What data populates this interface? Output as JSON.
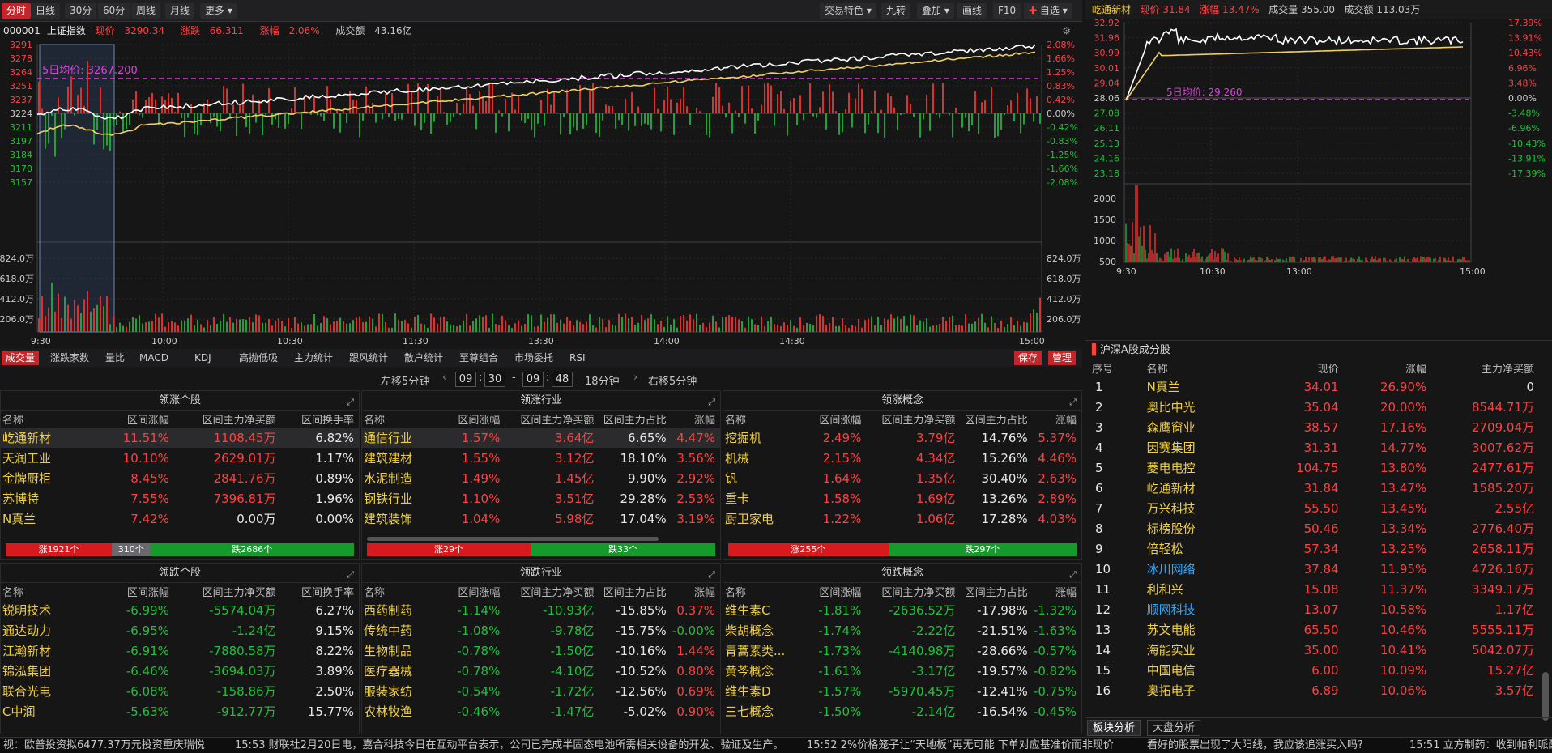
{
  "toolbar": {
    "left": [
      "分时",
      "日线",
      "30分",
      "60分",
      "周线",
      "月线",
      "更多"
    ],
    "right": [
      "交易特色",
      "九转",
      "叠加",
      "画线",
      "F10",
      "自选"
    ]
  },
  "index": {
    "code": "000001",
    "name": "上证指数",
    "price_label": "现价",
    "price": "3290.34",
    "change_label": "涨跌",
    "change": "66.311",
    "pct_label": "涨幅",
    "pct": "2.06%",
    "amount_label": "成交额",
    "amount": "43.16亿"
  },
  "main_chart": {
    "avg5_label": "5日均价: 3267.200",
    "y_left": [
      "3291",
      "3278",
      "3264",
      "3251",
      "3237",
      "3224",
      "3211",
      "3197",
      "3184",
      "3170",
      "3157"
    ],
    "y_right": [
      "2.08%",
      "1.66%",
      "1.25%",
      "0.83%",
      "0.42%",
      "0.00%",
      "-0.42%",
      "-0.83%",
      "-1.25%",
      "-1.66%",
      "-2.08%"
    ],
    "vol_left": [
      "824.0万",
      "618.0万",
      "412.0万",
      "206.0万"
    ],
    "vol_right": [
      "824.0万",
      "618.0万",
      "412.0万",
      "206.0万"
    ],
    "x": [
      "9:30",
      "10:00",
      "10:30",
      "11:30",
      "13:30",
      "14:00",
      "14:30",
      "15:00"
    ]
  },
  "indicators": [
    "成交量",
    "涨跌家数",
    "量比",
    "MACD",
    "KDJ",
    "高抛低吸",
    "主力统计",
    "跟风统计",
    "散户统计",
    "至尊组合",
    "市场委托",
    "RSI"
  ],
  "ind_right": [
    "保存",
    "管理"
  ],
  "timenav": {
    "left": "左移5分钟",
    "h1": "09",
    "m1": "30",
    "sep": "-",
    "h2": "09",
    "m2": "48",
    "dur": "18分钟",
    "right": "右移5分钟"
  },
  "panels": {
    "gain_stocks": {
      "title": "领涨个股",
      "headers": [
        "名称",
        "区间涨幅",
        "区间主力净买额",
        "区间换手率"
      ],
      "rows": [
        [
          "屹通新材",
          "11.51%",
          "1108.45万",
          "6.82%"
        ],
        [
          "天润工业",
          "10.10%",
          "2629.01万",
          "1.17%"
        ],
        [
          "金牌厨柜",
          "8.45%",
          "2841.76万",
          "0.89%"
        ],
        [
          "苏博特",
          "7.55%",
          "7396.81万",
          "1.96%"
        ],
        [
          "N真兰",
          "7.42%",
          "0.00万",
          "0.00%"
        ]
      ],
      "breadth": [
        "涨1921个",
        "310个",
        "跌2686个"
      ]
    },
    "gain_inds": {
      "title": "领涨行业",
      "headers": [
        "名称",
        "区间涨幅",
        "区间主力净买额",
        "区间主力占比",
        "涨幅"
      ],
      "rows": [
        [
          "通信行业",
          "1.57%",
          "3.64亿",
          "6.65%",
          "4.47%"
        ],
        [
          "建筑建材",
          "1.55%",
          "3.12亿",
          "18.10%",
          "3.56%"
        ],
        [
          "水泥制造",
          "1.49%",
          "1.45亿",
          "9.90%",
          "2.92%"
        ],
        [
          "钢铁行业",
          "1.10%",
          "3.51亿",
          "29.28%",
          "2.53%"
        ],
        [
          "建筑装饰",
          "1.04%",
          "5.98亿",
          "17.04%",
          "3.19%"
        ]
      ],
      "breadth": [
        "涨29个",
        "跌33个"
      ]
    },
    "gain_cons": {
      "title": "领涨概念",
      "headers": [
        "名称",
        "区间涨幅",
        "区间主力净买额",
        "区间主力占比",
        "涨幅"
      ],
      "rows": [
        [
          "挖掘机",
          "2.49%",
          "3.79亿",
          "14.76%",
          "5.37%"
        ],
        [
          "机械",
          "2.15%",
          "4.34亿",
          "15.26%",
          "4.46%"
        ],
        [
          "钒",
          "1.64%",
          "1.35亿",
          "30.40%",
          "2.63%"
        ],
        [
          "重卡",
          "1.58%",
          "1.69亿",
          "13.26%",
          "2.89%"
        ],
        [
          "厨卫家电",
          "1.22%",
          "1.06亿",
          "17.28%",
          "4.03%"
        ]
      ],
      "breadth": [
        "涨255个",
        "跌297个"
      ]
    },
    "loss_stocks": {
      "title": "领跌个股",
      "headers": [
        "名称",
        "区间涨幅",
        "区间主力净买额",
        "区间换手率"
      ],
      "rows": [
        [
          "锐明技术",
          "-6.99%",
          "-5574.04万",
          "6.27%"
        ],
        [
          "通达动力",
          "-6.95%",
          "-1.24亿",
          "9.15%"
        ],
        [
          "江瀚新材",
          "-6.91%",
          "-7880.58万",
          "8.22%"
        ],
        [
          "锦泓集团",
          "-6.46%",
          "-3694.03万",
          "3.89%"
        ],
        [
          "联合光电",
          "-6.08%",
          "-158.86万",
          "2.50%"
        ],
        [
          "C中润",
          "-5.63%",
          "-912.77万",
          "15.77%"
        ]
      ]
    },
    "loss_inds": {
      "title": "领跌行业",
      "headers": [
        "名称",
        "区间涨幅",
        "区间主力净买额",
        "区间主力占比",
        "涨幅"
      ],
      "rows": [
        [
          "西药制药",
          "-1.14%",
          "-10.93亿",
          "-15.85%",
          "0.37%"
        ],
        [
          "传统中药",
          "-1.08%",
          "-9.78亿",
          "-15.75%",
          "-0.00%"
        ],
        [
          "生物制品",
          "-0.78%",
          "-1.50亿",
          "-10.16%",
          "1.44%"
        ],
        [
          "医疗器械",
          "-0.78%",
          "-4.10亿",
          "-10.52%",
          "0.80%"
        ],
        [
          "服装家纺",
          "-0.54%",
          "-1.72亿",
          "-12.56%",
          "0.69%"
        ],
        [
          "农林牧渔",
          "-0.46%",
          "-1.47亿",
          "-5.02%",
          "0.90%"
        ]
      ]
    },
    "loss_cons": {
      "title": "领跌概念",
      "headers": [
        "名称",
        "区间涨幅",
        "区间主力净买额",
        "区间主力占比",
        "涨幅"
      ],
      "rows": [
        [
          "维生素C",
          "-1.81%",
          "-2636.52万",
          "-17.98%",
          "-1.32%"
        ],
        [
          "柴胡概念",
          "-1.74%",
          "-2.22亿",
          "-21.51%",
          "-1.63%"
        ],
        [
          "青蒿素类...",
          "-1.73%",
          "-4140.98万",
          "-28.66%",
          "-0.57%"
        ],
        [
          "黄芩概念",
          "-1.61%",
          "-3.17亿",
          "-19.57%",
          "-0.82%"
        ],
        [
          "维生素D",
          "-1.57%",
          "-5970.45万",
          "-12.41%",
          "-0.75%"
        ],
        [
          "三七概念",
          "-1.50%",
          "-2.14亿",
          "-16.54%",
          "-0.45%"
        ]
      ]
    }
  },
  "stock": {
    "name": "屹通新材",
    "price_label": "现价",
    "price": "31.84",
    "pct_label": "涨幅",
    "pct": "13.47%",
    "vol_label": "成交量",
    "vol": "355.00",
    "amt_label": "成交额",
    "amt": "113.03万",
    "avg5_label": "5日均价: 29.260",
    "y_left": [
      "32.92",
      "31.96",
      "30.99",
      "30.01",
      "29.04",
      "28.06",
      "27.08",
      "26.11",
      "25.13",
      "24.16",
      "23.18"
    ],
    "y_right": [
      "17.39%",
      "13.91%",
      "10.43%",
      "6.96%",
      "3.48%",
      "0.00%",
      "-3.48%",
      "-6.96%",
      "-10.43%",
      "-13.91%",
      "-17.39%"
    ],
    "vol_y": [
      "2000",
      "1500",
      "1000",
      "500"
    ],
    "x": [
      "9:30",
      "10:30",
      "13:00",
      "15:00"
    ]
  },
  "list": {
    "title": "沪深A股成分股",
    "headers": [
      "序号",
      "名称",
      "现价",
      "涨幅",
      "主力净买额"
    ],
    "rows": [
      [
        "1",
        "N真兰",
        "34.01",
        "26.90%",
        "0"
      ],
      [
        "2",
        "奥比中光",
        "35.04",
        "20.00%",
        "8544.71万"
      ],
      [
        "3",
        "森鹰窗业",
        "38.57",
        "17.16%",
        "2709.04万"
      ],
      [
        "4",
        "因赛集团",
        "31.31",
        "14.77%",
        "3007.62万"
      ],
      [
        "5",
        "菱电电控",
        "104.75",
        "13.80%",
        "2477.61万"
      ],
      [
        "6",
        "屹通新材",
        "31.84",
        "13.47%",
        "1585.20万"
      ],
      [
        "7",
        "万兴科技",
        "55.50",
        "13.45%",
        "2.55亿"
      ],
      [
        "8",
        "标榜股份",
        "50.46",
        "13.34%",
        "2776.40万"
      ],
      [
        "9",
        "倍轻松",
        "57.34",
        "13.25%",
        "2658.11万"
      ],
      [
        "10",
        "冰川网络",
        "37.84",
        "11.95%",
        "4726.16万"
      ],
      [
        "11",
        "利和兴",
        "15.08",
        "11.37%",
        "3349.17万"
      ],
      [
        "12",
        "顺网科技",
        "13.07",
        "10.58%",
        "1.17亿"
      ],
      [
        "13",
        "苏文电能",
        "65.50",
        "10.46%",
        "5555.11万"
      ],
      [
        "14",
        "海能实业",
        "35.00",
        "10.41%",
        "5042.07万"
      ],
      [
        "15",
        "中国电信",
        "6.00",
        "10.09%",
        "15.27亿"
      ],
      [
        "16",
        "奥拓电子",
        "6.89",
        "10.06%",
        "3.57亿"
      ]
    ]
  },
  "rtabs": [
    "板块分析",
    "大盘分析"
  ],
  "ticker": [
    "视：欧普投资拟6477.37万元投资重庆瑞悦",
    "15:53 财联社2月20日电，嘉合科技今日在互动平台表示，公司已完成半固态电池所需相关设备的开发、验证及生产。",
    "15:52 2%价格笼子让“天地板”再无可能 下单对应基准价而非现价",
    "看好的股票出现了大阳线，我应该追涨买入吗?",
    "15:51 立方制药：收到帕利哌酮"
  ]
}
